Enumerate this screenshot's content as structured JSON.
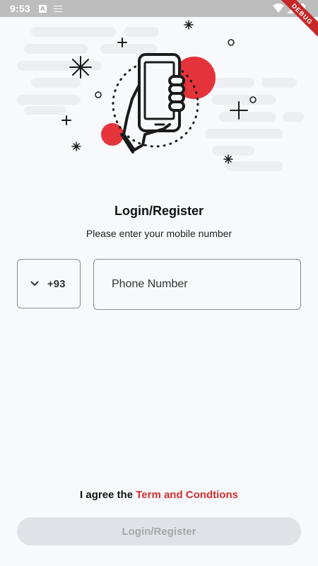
{
  "status_bar": {
    "time": "9:53",
    "notification_icon": "A",
    "debug_label": "DEBUG"
  },
  "illustration": {
    "icon": "hand-holding-phone-illustration",
    "accent_color": "#e5333b"
  },
  "login": {
    "title": "Login/Register",
    "subtitle": "Please enter your mobile number",
    "country_code": "+93",
    "phone_placeholder": "Phone Number",
    "phone_value": "",
    "terms_prefix": "I agree the ",
    "terms_link": "Term and Condtions",
    "submit_label": "Login/Register"
  },
  "colors": {
    "background": "#f7f9fd",
    "link": "#d32f2f",
    "button_disabled_bg": "#dfe2e7",
    "button_disabled_text": "#a5a7aa"
  }
}
